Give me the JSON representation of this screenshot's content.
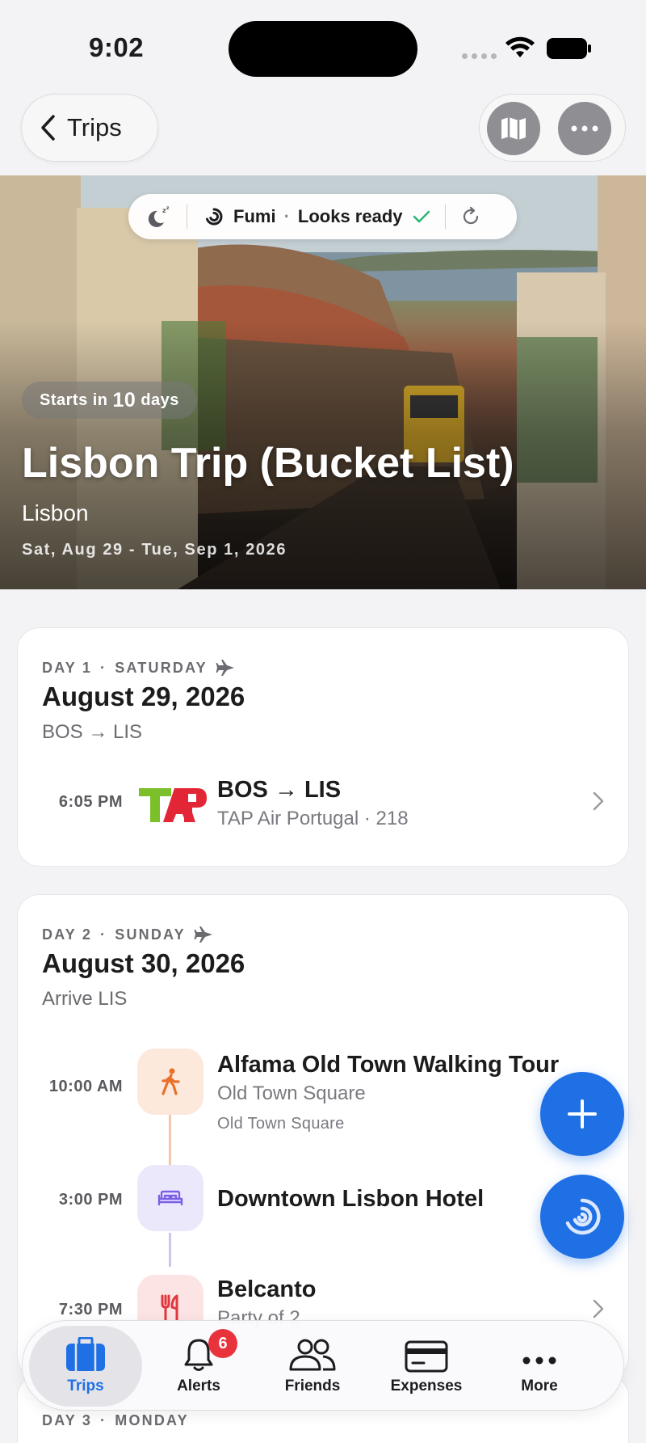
{
  "status_bar": {
    "time": "9:02"
  },
  "nav": {
    "back_label": "Trips"
  },
  "hero": {
    "fumi_name": "Fumi",
    "fumi_status": "Looks ready",
    "starts_prefix": "Starts in",
    "starts_days": "10",
    "starts_suffix": "days",
    "title": "Lisbon Trip (Bucket List)",
    "city": "Lisbon",
    "dates": "Sat, Aug 29 - Tue, Sep 1, 2026"
  },
  "days": [
    {
      "label": "DAY 1",
      "weekday": "SATURDAY",
      "date": "August 29, 2026",
      "subtitle": "BOS → LIS",
      "items": [
        {
          "time": "6:05 PM",
          "title": "BOS → LIS",
          "subtitle": "TAP Air Portugal · 218",
          "logo_text": "TAP"
        }
      ]
    },
    {
      "label": "DAY 2",
      "weekday": "SUNDAY",
      "date": "August 30, 2026",
      "subtitle": "Arrive LIS",
      "items": [
        {
          "time": "10:00 AM",
          "title": "Alfama Old Town Walking Tour",
          "subtitle": "Old Town Square",
          "detail": "Old Town Square",
          "icon": "walking-person-icon"
        },
        {
          "time": "3:00 PM",
          "title": "Downtown Lisbon Hotel",
          "icon": "bed-icon"
        },
        {
          "time": "7:30 PM",
          "title": "Belcanto",
          "subtitle": "Party of 2",
          "icon": "fork-knife-icon"
        }
      ]
    },
    {
      "label": "DAY 3",
      "weekday": "MONDAY"
    }
  ],
  "tabbar": {
    "tabs": [
      {
        "label": "Trips",
        "icon": "suitcase-icon"
      },
      {
        "label": "Alerts",
        "icon": "bell-icon",
        "badge": "6"
      },
      {
        "label": "Friends",
        "icon": "people-icon"
      },
      {
        "label": "Expenses",
        "icon": "card-icon"
      },
      {
        "label": "More",
        "icon": "ellipsis-icon"
      }
    ]
  },
  "colors": {
    "accent": "#1f6fe5",
    "badge": "#e8323c",
    "check": "#2bb673"
  }
}
